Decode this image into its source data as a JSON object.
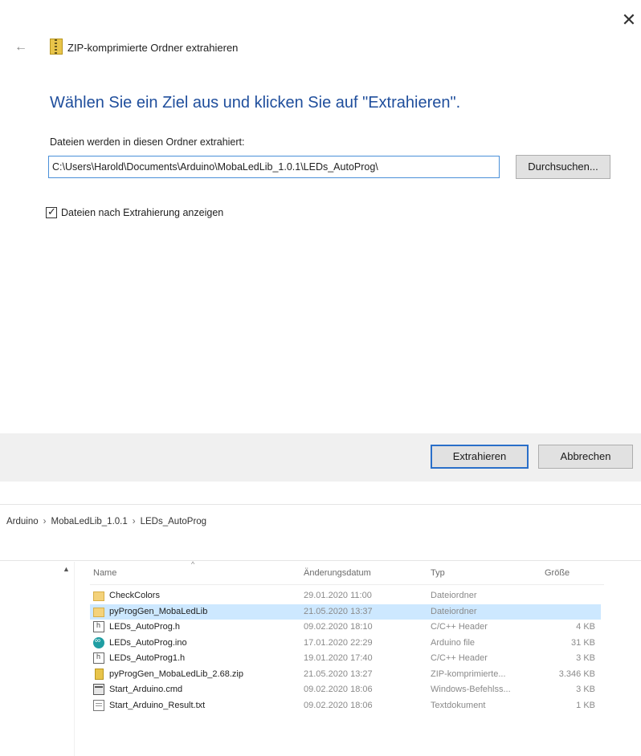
{
  "dialog": {
    "close_glyph": "✕",
    "back_glyph": "←",
    "title": "ZIP-komprimierte Ordner extrahieren",
    "heading": "Wählen Sie ein Ziel aus und klicken Sie auf \"Extrahieren\".",
    "destination_label": "Dateien werden in diesen Ordner extrahiert:",
    "destination_path": "C:\\Users\\Harold\\Documents\\Arduino\\MobaLedLib_1.0.1\\LEDs_AutoProg\\",
    "browse_label": "Durchsuchen...",
    "show_files_label": "Dateien nach Extrahierung anzeigen",
    "show_files_checked": true,
    "extract_label": "Extrahieren",
    "cancel_label": "Abbrechen",
    "accent_color": "#1f4e9c"
  },
  "explorer": {
    "breadcrumb": [
      "Arduino",
      "MobaLedLib_1.0.1",
      "LEDs_AutoProg"
    ],
    "breadcrumb_separator": "›",
    "columns": {
      "name": "Name",
      "date": "Änderungsdatum",
      "type": "Typ",
      "size": "Größe"
    },
    "files": [
      {
        "name": "CheckColors",
        "date": "29.01.2020 11:00",
        "type": "Dateiordner",
        "size": "",
        "icon": "folder-icon",
        "selected": false
      },
      {
        "name": "pyProgGen_MobaLedLib",
        "date": "21.05.2020 13:37",
        "type": "Dateiordner",
        "size": "",
        "icon": "folder-icon",
        "selected": true
      },
      {
        "name": "LEDs_AutoProg.h",
        "date": "09.02.2020 18:10",
        "type": "C/C++ Header",
        "size": "4 KB",
        "icon": "header-file-icon",
        "selected": false
      },
      {
        "name": "LEDs_AutoProg.ino",
        "date": "17.01.2020 22:29",
        "type": "Arduino file",
        "size": "31 KB",
        "icon": "arduino-file-icon",
        "selected": false
      },
      {
        "name": "LEDs_AutoProg1.h",
        "date": "19.01.2020 17:40",
        "type": "C/C++ Header",
        "size": "3 KB",
        "icon": "header-file-icon",
        "selected": false
      },
      {
        "name": "pyProgGen_MobaLedLib_2.68.zip",
        "date": "21.05.2020 13:27",
        "type": "ZIP-komprimierte...",
        "size": "3.346 KB",
        "icon": "zip-file-icon",
        "selected": false
      },
      {
        "name": "Start_Arduino.cmd",
        "date": "09.02.2020 18:06",
        "type": "Windows-Befehlss...",
        "size": "3 KB",
        "icon": "cmd-file-icon",
        "selected": false
      },
      {
        "name": "Start_Arduino_Result.txt",
        "date": "09.02.2020 18:06",
        "type": "Textdokument",
        "size": "1 KB",
        "icon": "text-file-icon",
        "selected": false
      }
    ]
  }
}
